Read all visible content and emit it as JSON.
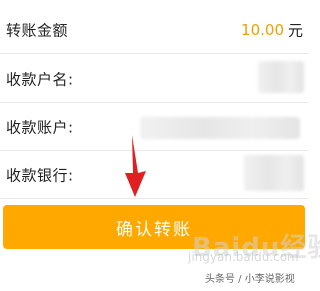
{
  "form": {
    "amount_label": "转账金额",
    "amount_value": "10.00",
    "amount_unit": "元",
    "payee_name_label": "收款户名:",
    "payee_account_label": "收款账户:",
    "payee_bank_label": "收款银行:"
  },
  "confirm_button_label": "确认转账",
  "watermark": {
    "logo_text": "Baidu经验",
    "sub_text": "jingyan.baidu.com"
  },
  "credit_text": "头条号 / 小李说影视",
  "colors": {
    "accent": "#fea800",
    "amount_text": "#f0a000",
    "arrow": "#e02020"
  },
  "icons": [
    "red-arrow-annotation"
  ]
}
